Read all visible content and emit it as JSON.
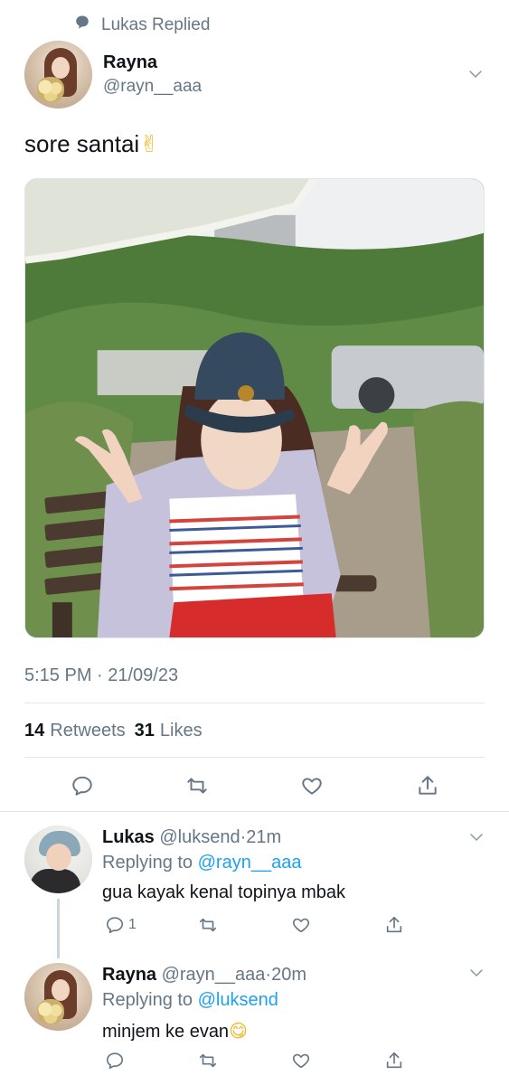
{
  "social_context": {
    "text": "Lukas Replied",
    "icon": "speech-bubble-icon"
  },
  "main_tweet": {
    "author_name": "Rayna",
    "author_handle": "@rayn__aaa",
    "text": "sore santai",
    "text_emoji": "✌",
    "timestamp": "5:15 PM · 21/09/23",
    "retweets_count": "14",
    "retweets_label": "Retweets",
    "likes_count": "31",
    "likes_label": "Likes"
  },
  "replies": [
    {
      "author_name": "Lukas",
      "author_handle": "@luksend",
      "time": "21m",
      "replying_label": "Replying to",
      "replying_to": "@rayn__aaa",
      "text": "gua kayak kenal topinya mbak",
      "text_emoji": "",
      "reply_count": "1"
    },
    {
      "author_name": "Rayna",
      "author_handle": "@rayn__aaa",
      "time": "20m",
      "replying_label": "Replying to",
      "replying_to": "@luksend",
      "text": "minjem ke evan",
      "text_emoji": "😋",
      "reply_count": ""
    }
  ],
  "colors": {
    "link": "#1da1f2",
    "muted": "#657786",
    "text": "#0f1419",
    "divider": "#e1e8ed"
  }
}
